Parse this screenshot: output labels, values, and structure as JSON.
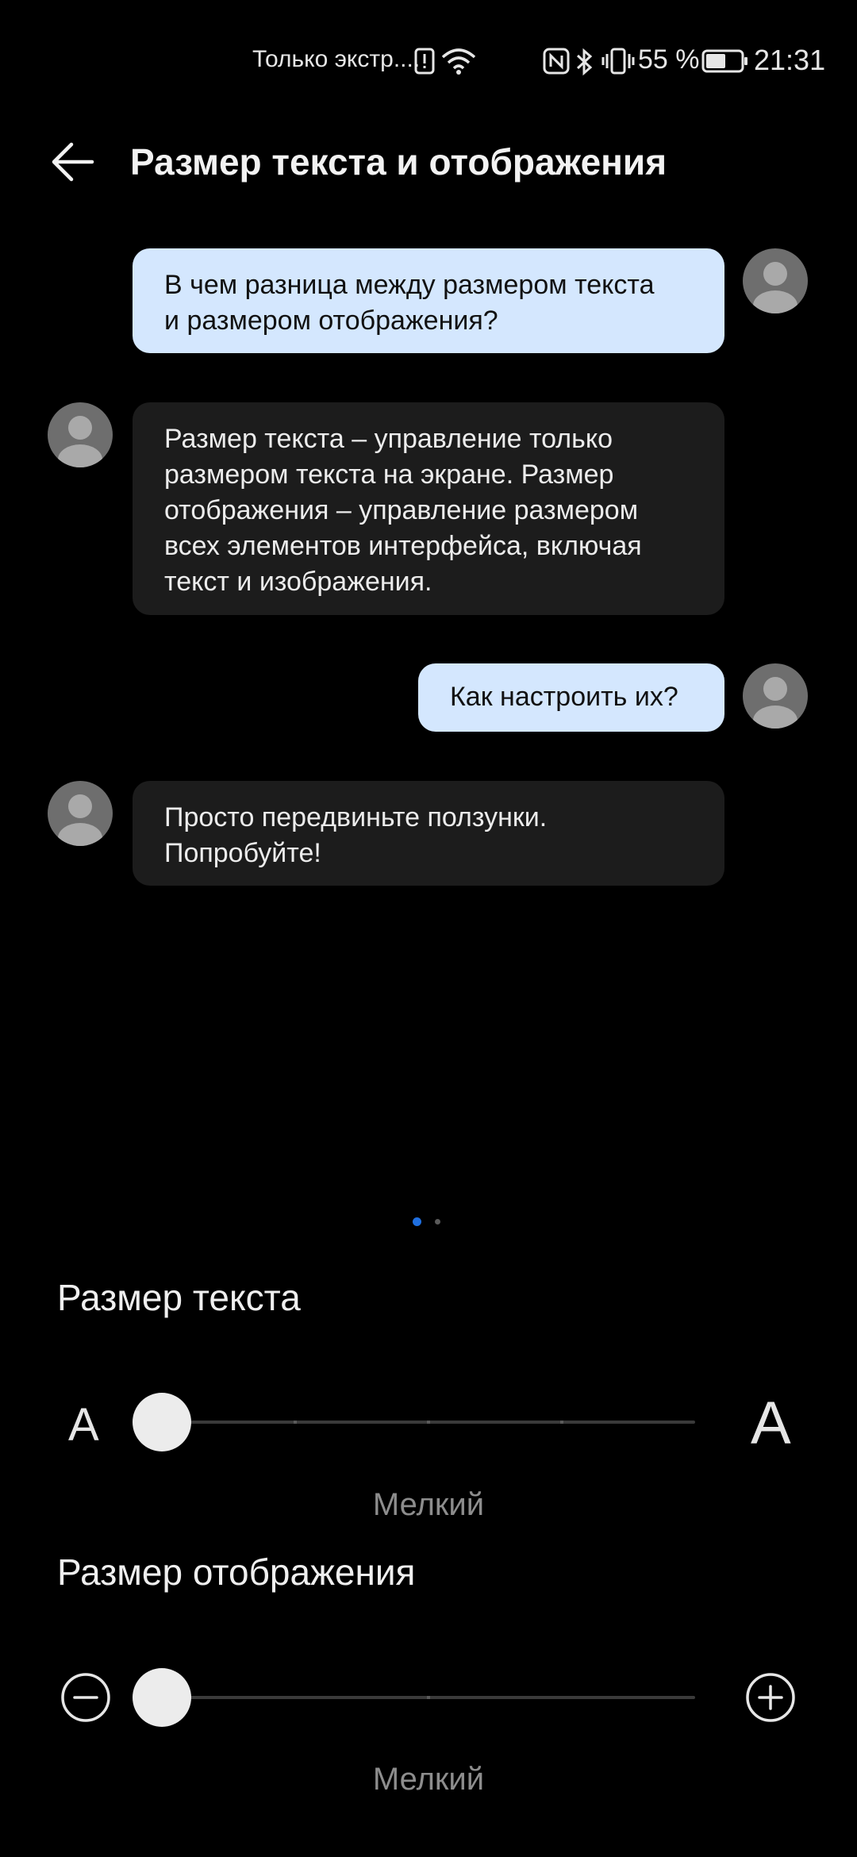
{
  "status_bar": {
    "carrier_text": "Только экстр....",
    "battery_text": "55 %",
    "time": "21:31",
    "icons": [
      "alert-icon",
      "wifi-icon",
      "nfc-icon",
      "bluetooth-icon",
      "vibrate-icon",
      "battery-icon"
    ]
  },
  "header": {
    "back_icon": "arrow-left-icon",
    "title": "Размер текста и отображения"
  },
  "chat": [
    {
      "from": "user",
      "lines": [
        "В чем разница между размером текста",
        "и размером отображения?"
      ]
    },
    {
      "from": "bot",
      "lines": [
        "Размер текста – управление только",
        "размером текста на экране. Размер",
        "отображения – управление размером",
        "всех элементов интерфейса, включая",
        "текст и изображения."
      ]
    },
    {
      "from": "user",
      "lines": [
        "Как настроить их?"
      ]
    },
    {
      "from": "bot",
      "lines": [
        "Просто передвиньте ползунки.",
        "Попробуйте!"
      ]
    }
  ],
  "pager": {
    "pages": 2,
    "active_index": 0,
    "active_color": "#1f6fe0",
    "inactive_color": "#5a5a5a"
  },
  "text_size": {
    "title": "Размер текста",
    "min_icon_glyph": "A",
    "max_icon_glyph": "A",
    "steps": 5,
    "current_step": 0,
    "value_label": "Мелкий"
  },
  "display_size": {
    "title": "Размер отображения",
    "min_icon": "minus-circle-icon",
    "max_icon": "plus-circle-icon",
    "steps": 3,
    "current_step": 0,
    "value_label": "Мелкий"
  },
  "colors": {
    "background": "#000000",
    "user_bubble": "#d4e7fe",
    "bot_bubble": "#1c1c1c",
    "accent": "#1f6fe0"
  }
}
